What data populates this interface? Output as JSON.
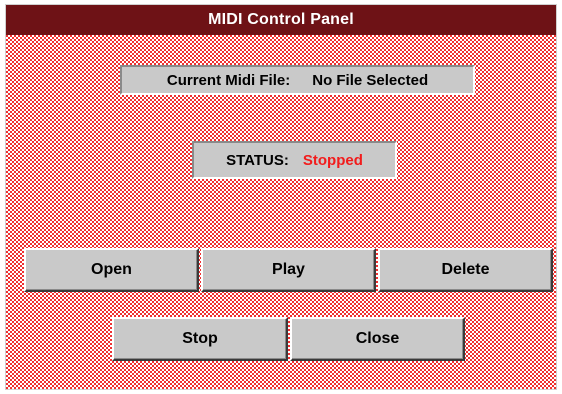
{
  "window": {
    "title": "MIDI Control Panel"
  },
  "file_info": {
    "label": "Current Midi File:",
    "value": "No File Selected"
  },
  "status": {
    "label": "STATUS:",
    "value": "Stopped",
    "value_color": "#f21c1c"
  },
  "buttons": {
    "open": "Open",
    "play": "Play",
    "delete": "Delete",
    "stop": "Stop",
    "close": "Close"
  },
  "colors": {
    "titlebar": "#6e1216",
    "background_dither": "#f03030",
    "control_face": "#c9c9c9"
  }
}
